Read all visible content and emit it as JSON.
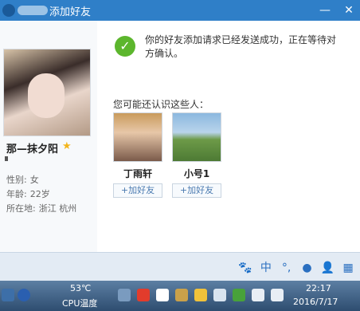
{
  "window": {
    "title": "添加好友"
  },
  "profile": {
    "nickname": "那—抹夕阳",
    "gender_label": "性别:",
    "gender": "女",
    "age_label": "年龄:",
    "age": "22岁",
    "location_label": "所在地:",
    "location": "浙江  杭州"
  },
  "message": "你的好友添加请求已经发送成功，正在等待对方确认。",
  "suggest_title": "您可能还认识这些人：",
  "people": [
    {
      "name": "丁雨轩",
      "add_label": "+加好友"
    },
    {
      "name": "小号1",
      "add_label": "+加好友"
    }
  ],
  "ime": [
    "🐾",
    "中",
    "°,",
    "●",
    "👤",
    "▦"
  ],
  "taskbar": {
    "temperature": "53℃",
    "cpu_label": "CPU温度",
    "time": "22:17",
    "date": "2016/7/17"
  }
}
